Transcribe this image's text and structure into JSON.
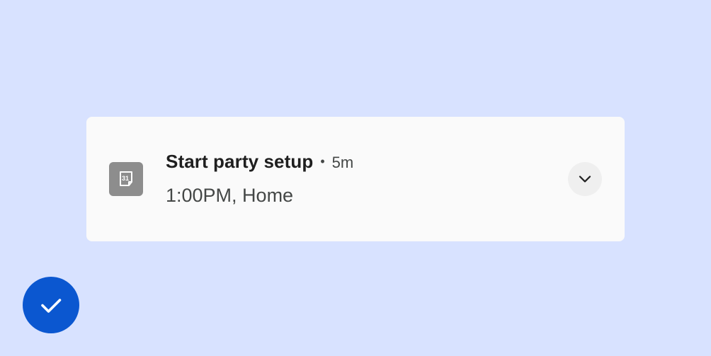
{
  "colors": {
    "background": "#d8e2ff",
    "card": "#fafafa",
    "app_icon": "#8d8d8d",
    "expand_button": "#efefef",
    "fab": "#0b57d0"
  },
  "notification": {
    "app_icon": "calendar-icon",
    "calendar_day": "31",
    "title": "Start party setup",
    "separator": "•",
    "time": "5m",
    "body": "1:00PM, Home",
    "expand_icon": "chevron-down-icon"
  },
  "fab": {
    "icon": "check-icon"
  }
}
